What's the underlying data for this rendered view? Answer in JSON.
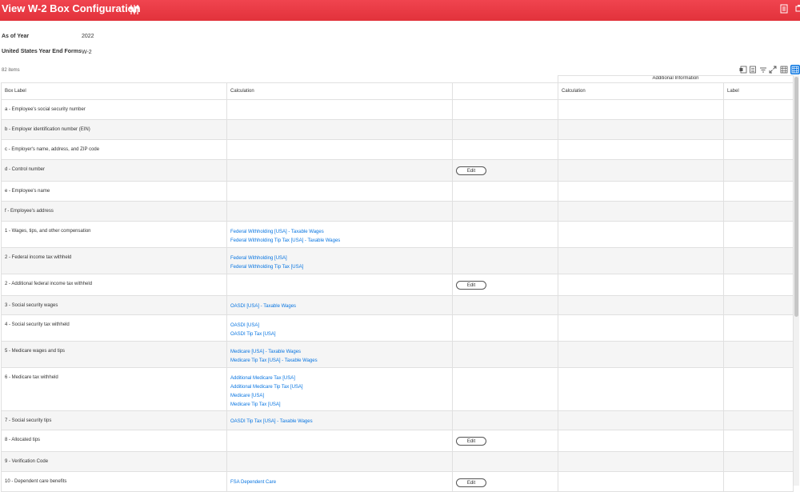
{
  "header": {
    "title": "View W-2 Box Configuration",
    "related_actions_icon": "related-actions-icon",
    "right_icons": [
      "export-icon",
      "print-icon"
    ],
    "accent_color": "#e63a43"
  },
  "fields": [
    {
      "label": "As of Year",
      "value": "2022"
    },
    {
      "label": "United States Year End Forms",
      "value": "W-2"
    }
  ],
  "grid": {
    "count": "82 items",
    "toolbar_icons": [
      "export-to-excel-icon",
      "export-to-pdf-icon",
      "filter-icon",
      "fullscreen-icon",
      "table-view-icon",
      "grid-view-icon"
    ],
    "group_header": "Additional Information",
    "columns": [
      "Box Label",
      "Calculation",
      "",
      "Calculation",
      "Label"
    ],
    "edit_label": "Edit",
    "link_color": "#0875e1",
    "rows": [
      {
        "label": "a - Employee's social security number",
        "calcs": [],
        "edit": false
      },
      {
        "label": "b - Employer identification number (EIN)",
        "calcs": [],
        "edit": false
      },
      {
        "label": "c - Employer's name, address, and ZIP code",
        "calcs": [],
        "edit": false
      },
      {
        "label": "d - Control number",
        "calcs": [],
        "edit": true
      },
      {
        "label": "e - Employee's name",
        "calcs": [],
        "edit": false
      },
      {
        "label": "f - Employee's address",
        "calcs": [],
        "edit": false
      },
      {
        "label": "1 - Wages, tips, and other compensation",
        "calcs": [
          "Federal Withholding [USA] - Taxable Wages",
          "Federal Withholding Tip Tax [USA] - Taxable Wages"
        ],
        "edit": false
      },
      {
        "label": "2 - Federal income tax withheld",
        "calcs": [
          "Federal Withholding [USA]",
          "Federal Withholding Tip Tax [USA]"
        ],
        "edit": false
      },
      {
        "label": "2 - Additional federal income tax withheld",
        "calcs": [],
        "edit": true
      },
      {
        "label": "3 - Social security wages",
        "calcs": [
          "OASDI [USA] - Taxable Wages"
        ],
        "edit": false
      },
      {
        "label": "4 - Social security tax withheld",
        "calcs": [
          "OASDI [USA]",
          "OASDI Tip Tax [USA]"
        ],
        "edit": false
      },
      {
        "label": "5 - Medicare wages and tips",
        "calcs": [
          "Medicare [USA] - Taxable Wages",
          "Medicare Tip Tax [USA] - Taxable Wages"
        ],
        "edit": false
      },
      {
        "label": "6 - Medicare tax withheld",
        "calcs": [
          "Additional Medicare Tax [USA]",
          "Additional Medicare Tip Tax [USA]",
          "Medicare [USA]",
          "Medicare Tip Tax [USA]"
        ],
        "edit": false
      },
      {
        "label": "7 - Social security tips",
        "calcs": [
          "OASDI Tip Tax [USA] - Taxable Wages"
        ],
        "edit": false
      },
      {
        "label": "8 - Allocated tips",
        "calcs": [],
        "edit": true
      },
      {
        "label": "9 - Verification Code",
        "calcs": [],
        "edit": false
      },
      {
        "label": "10 - Dependent care benefits",
        "calcs": [
          "FSA Dependent Care"
        ],
        "edit": true
      }
    ]
  }
}
